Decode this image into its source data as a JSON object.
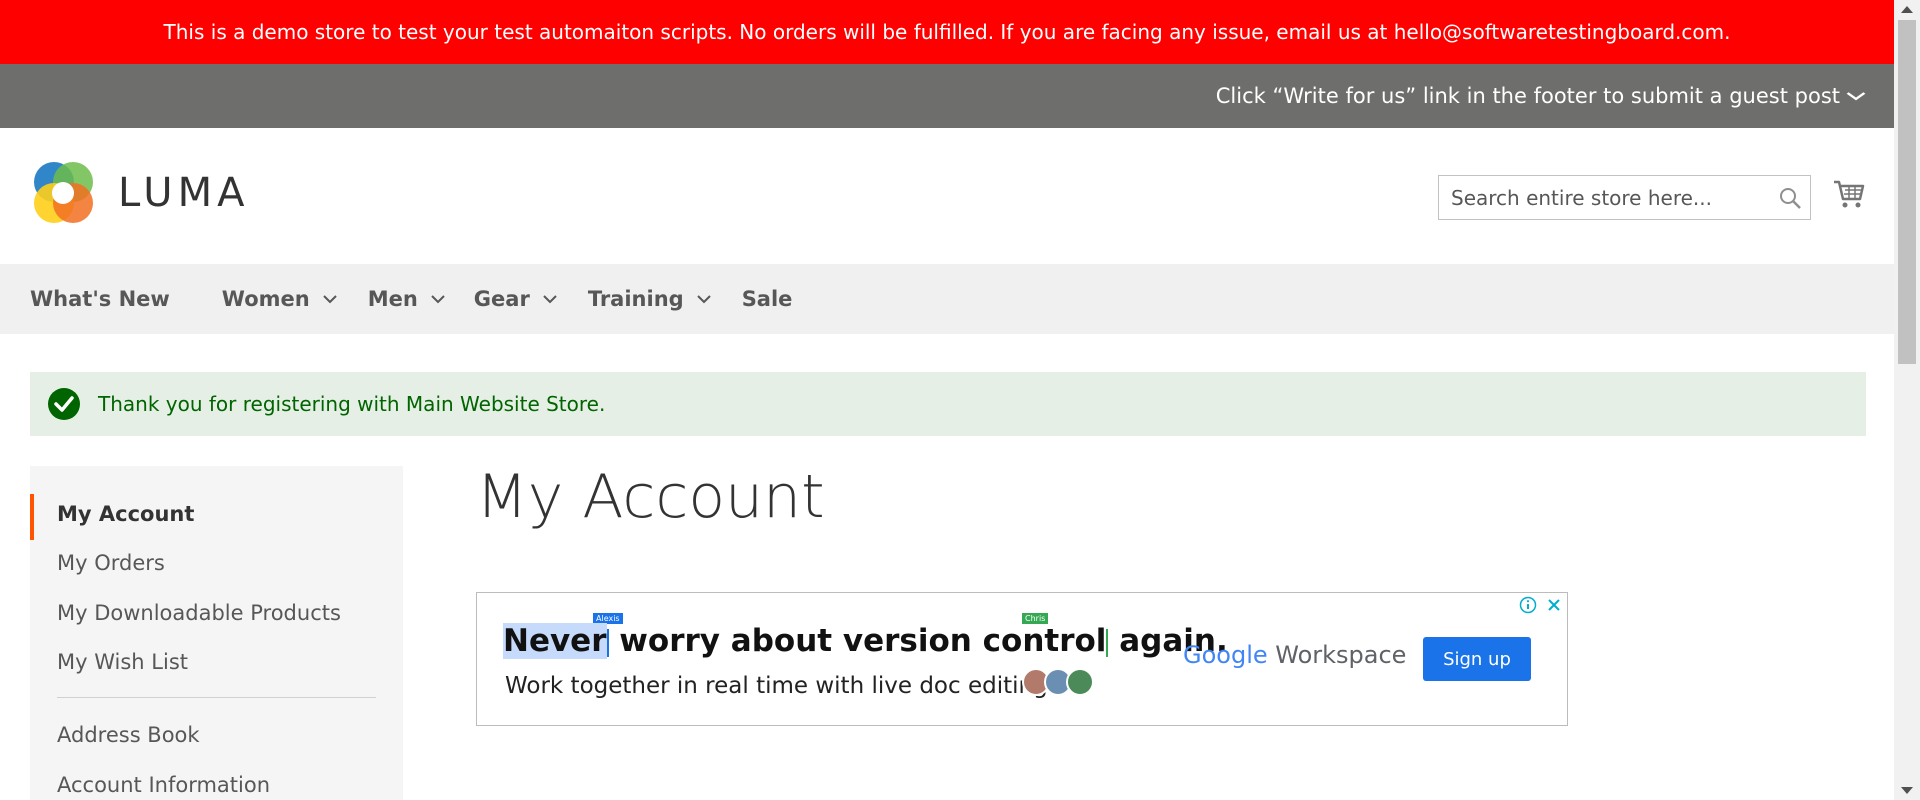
{
  "banner": {
    "demo_text": "This is a demo store to test your test automaiton scripts. No orders will be fulfilled. If you are facing any issue, email us at hello@softwaretestingboard.com.",
    "promo_text": "Click “Write for us” link in the footer to submit a guest post"
  },
  "header": {
    "logo_text": "LUMA",
    "search_placeholder": "Search entire store here...",
    "icons": [
      "luma-logo-icon",
      "search-icon",
      "cart-icon"
    ]
  },
  "nav": {
    "items": [
      {
        "label": "What's New",
        "has_dropdown": false
      },
      {
        "label": "Women",
        "has_dropdown": true
      },
      {
        "label": "Men",
        "has_dropdown": true
      },
      {
        "label": "Gear",
        "has_dropdown": true
      },
      {
        "label": "Training",
        "has_dropdown": true
      },
      {
        "label": "Sale",
        "has_dropdown": false
      }
    ]
  },
  "message": {
    "text": "Thank you for registering with Main Website Store.",
    "icon": "check-circle-icon"
  },
  "sidebar": {
    "items": [
      {
        "label": "My Account",
        "active": true
      },
      {
        "label": "My Orders"
      },
      {
        "label": "My Downloadable Products"
      },
      {
        "label": "My Wish List"
      },
      {
        "label": "Address Book"
      },
      {
        "label": "Account Information"
      }
    ]
  },
  "main": {
    "title": "My Account"
  },
  "ad": {
    "headline_highlight": "Never",
    "headline_rest": " worry about version control",
    "headline_end": " again.",
    "subtext": "Work together in real time with live doc editing.",
    "cursor_label_1": "Alexis",
    "cursor_label_2": "Chris",
    "brand_google": "Google",
    "brand_workspace": " Workspace",
    "cta": "Sign up",
    "icons": [
      "ad-info-icon",
      "ad-close-icon"
    ]
  },
  "colors": {
    "demo_banner": "#ff0000",
    "promo_bar": "#6e6e6c",
    "nav_bg": "#f0f0f0",
    "message_bg": "#e5efe5",
    "message_text": "#006400",
    "sidebar_active": "#ff5501",
    "signup_button": "#1a73e8"
  }
}
